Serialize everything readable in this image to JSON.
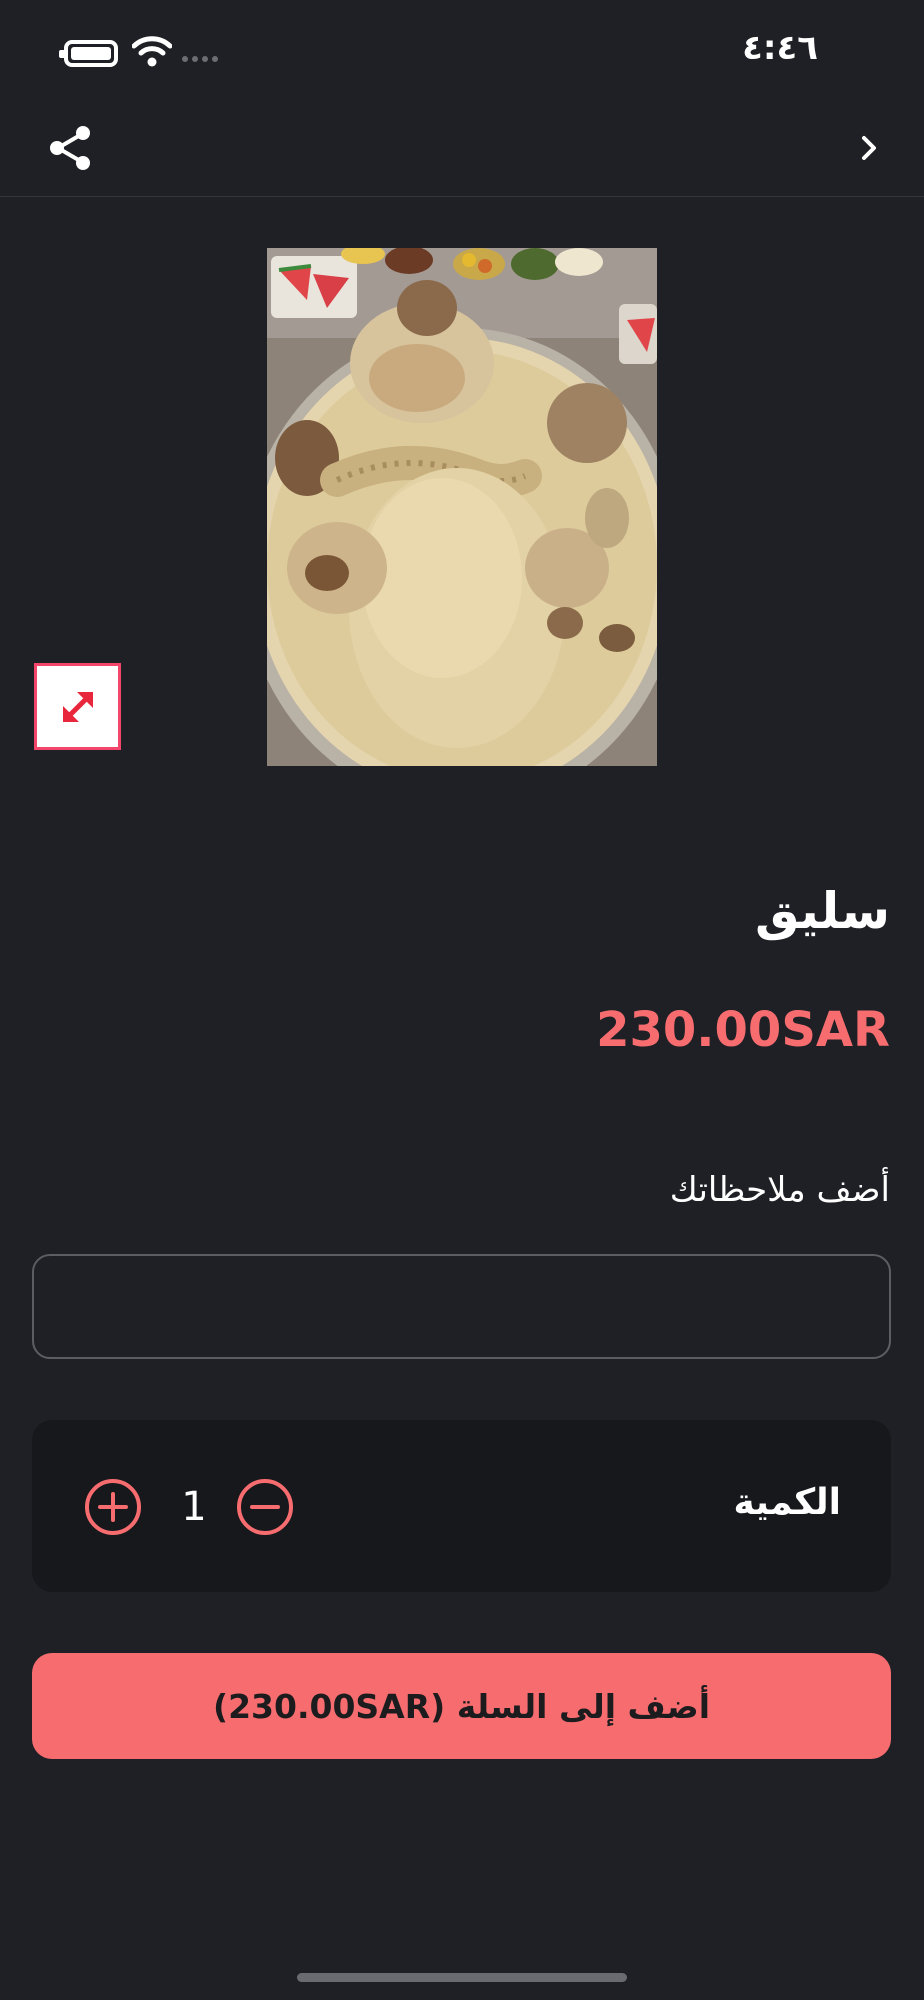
{
  "status_bar": {
    "time": "٤:٤٦",
    "icons": [
      "battery-icon",
      "wifi-icon",
      "signal-dots-icon"
    ]
  },
  "nav": {
    "icons": [
      "share-icon",
      "chevron-right-icon"
    ]
  },
  "product": {
    "image_icon": "food-photo",
    "expand_icon": "expand-arrows-icon",
    "name": "سليق",
    "price": "230.00SAR"
  },
  "notes": {
    "label": "أضف ملاحظاتك",
    "value": "",
    "placeholder": ""
  },
  "quantity": {
    "label": "الكمية",
    "value": "1",
    "icons": [
      "plus-circle-icon",
      "minus-circle-icon"
    ]
  },
  "cart": {
    "button_label": "أضف إلى السلة (230.00SAR)"
  },
  "colors": {
    "background": "#1f2025",
    "accent": "#f76d6f",
    "card": "#17181c",
    "expand_border": "#f4466a"
  }
}
